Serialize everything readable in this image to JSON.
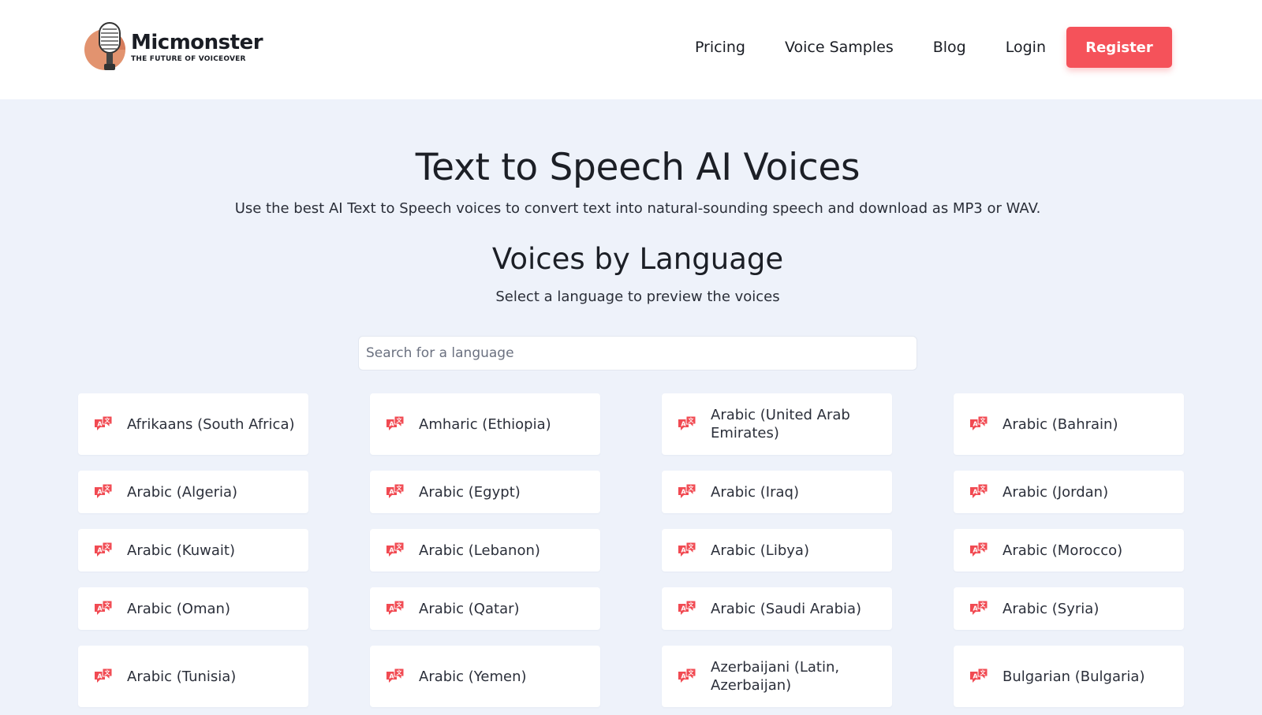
{
  "brand": {
    "name": "Micmonster",
    "tagline": "THE FUTURE OF VOICEOVER"
  },
  "nav": {
    "links": [
      "Pricing",
      "Voice Samples",
      "Blog",
      "Login"
    ],
    "register_label": "Register"
  },
  "hero": {
    "title": "Text to Speech AI Voices",
    "subtitle": "Use the best AI Text to Speech voices to convert text into natural-sounding speech and download as MP3 or WAV."
  },
  "languages_section": {
    "title": "Voices by Language",
    "subtitle": "Select a language to preview the voices",
    "search_placeholder": "Search for a language",
    "items": [
      "Afrikaans (South Africa)",
      "Amharic (Ethiopia)",
      "Arabic (United Arab Emirates)",
      "Arabic (Bahrain)",
      "Arabic (Algeria)",
      "Arabic (Egypt)",
      "Arabic (Iraq)",
      "Arabic (Jordan)",
      "Arabic (Kuwait)",
      "Arabic (Lebanon)",
      "Arabic (Libya)",
      "Arabic (Morocco)",
      "Arabic (Oman)",
      "Arabic (Qatar)",
      "Arabic (Saudi Arabia)",
      "Arabic (Syria)",
      "Arabic (Tunisia)",
      "Arabic (Yemen)",
      "Azerbaijani (Latin, Azerbaijan)",
      "Bulgarian (Bulgaria)"
    ]
  },
  "icons": {
    "logo": "microphone-logo-icon",
    "language": "translate-bubble-icon"
  },
  "colors": {
    "accent": "#f5525a",
    "page_background": "#eef2fa",
    "card_background": "#ffffff"
  }
}
